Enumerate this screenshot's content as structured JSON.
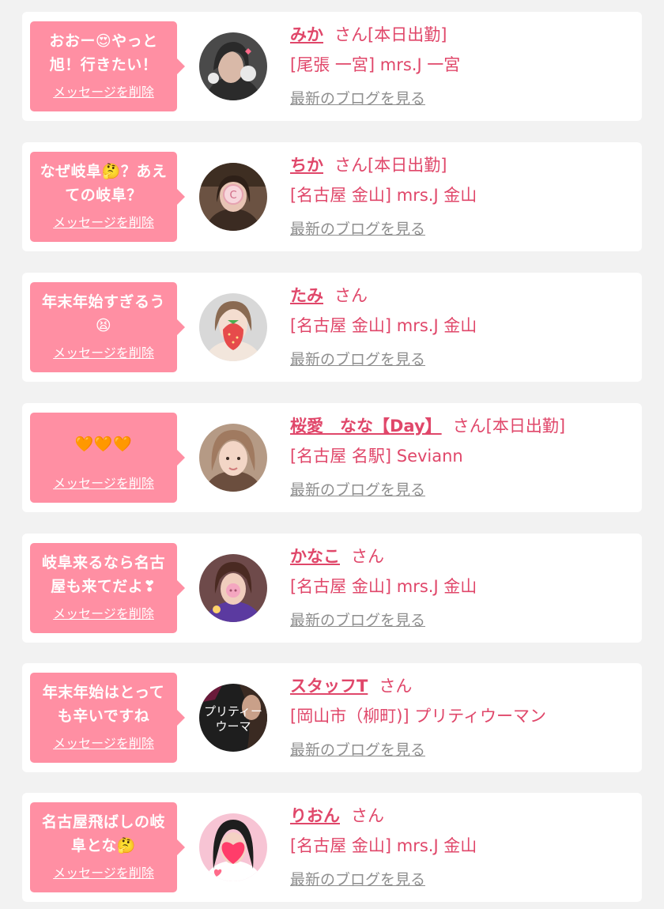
{
  "items": [
    {
      "message": "おおー😍やっと\n旭！行きたい！",
      "delete_label": "メッセージを削除",
      "name": "みか",
      "suffix": "さん[本日出勤]",
      "shop": "[尾張 一宮] mrs.J 一宮",
      "blog_label": "最新のブログを見る",
      "avatar_colors": [
        "#3a3a3a",
        "#d9b9a8"
      ]
    },
    {
      "message": "なぜ岐阜🤔？あえ\nての岐阜？",
      "delete_label": "メッセージを削除",
      "name": "ちか",
      "suffix": "さん[本日出勤]",
      "shop": "[名古屋 金山] mrs.J 金山",
      "blog_label": "最新のブログを見る",
      "avatar_colors": [
        "#5a4030",
        "#f2c9c9"
      ]
    },
    {
      "message": "年末年始すぎるう\n😫",
      "delete_label": "メッセージを削除",
      "name": "たみ",
      "suffix": "さん",
      "shop": "[名古屋 金山] mrs.J 金山",
      "blog_label": "最新のブログを見る",
      "avatar_colors": [
        "#cfcfcf",
        "#e64b4b"
      ]
    },
    {
      "message": "🧡🧡🧡",
      "delete_label": "メッセージを削除",
      "name": "桜愛　なな【Day】",
      "suffix": "さん[本日出勤]",
      "shop": "[名古屋 名駅] Seviann",
      "blog_label": "最新のブログを見る",
      "avatar_colors": [
        "#8a6a55",
        "#f0d2c2"
      ]
    },
    {
      "message": "岐阜来るなら名古\n屋も来てだよ❣",
      "delete_label": "メッセージを削除",
      "name": "かなこ",
      "suffix": "さん",
      "shop": "[名古屋 金山] mrs.J 金山",
      "blog_label": "最新のブログを見る",
      "avatar_colors": [
        "#4a2a2a",
        "#f4a6c0"
      ]
    },
    {
      "message": "年末年始はとって\nも辛いですね",
      "delete_label": "メッセージを削除",
      "name": "スタッフT",
      "suffix": "さん",
      "shop": "[岡山市（柳町)] プリティウーマン",
      "blog_label": "最新のブログを見る",
      "avatar_colors": [
        "#1e1e1e",
        "#ffffff"
      ],
      "avatar_text": "プリティー\nウーマ"
    },
    {
      "message": "名古屋飛ばしの岐\n阜とな🤔",
      "delete_label": "メッセージを削除",
      "name": "りおん",
      "suffix": "さん",
      "shop": "[名古屋 金山] mrs.J 金山",
      "blog_label": "最新のブログを見る",
      "avatar_colors": [
        "#f7c4d4",
        "#ff3d6a"
      ]
    }
  ]
}
